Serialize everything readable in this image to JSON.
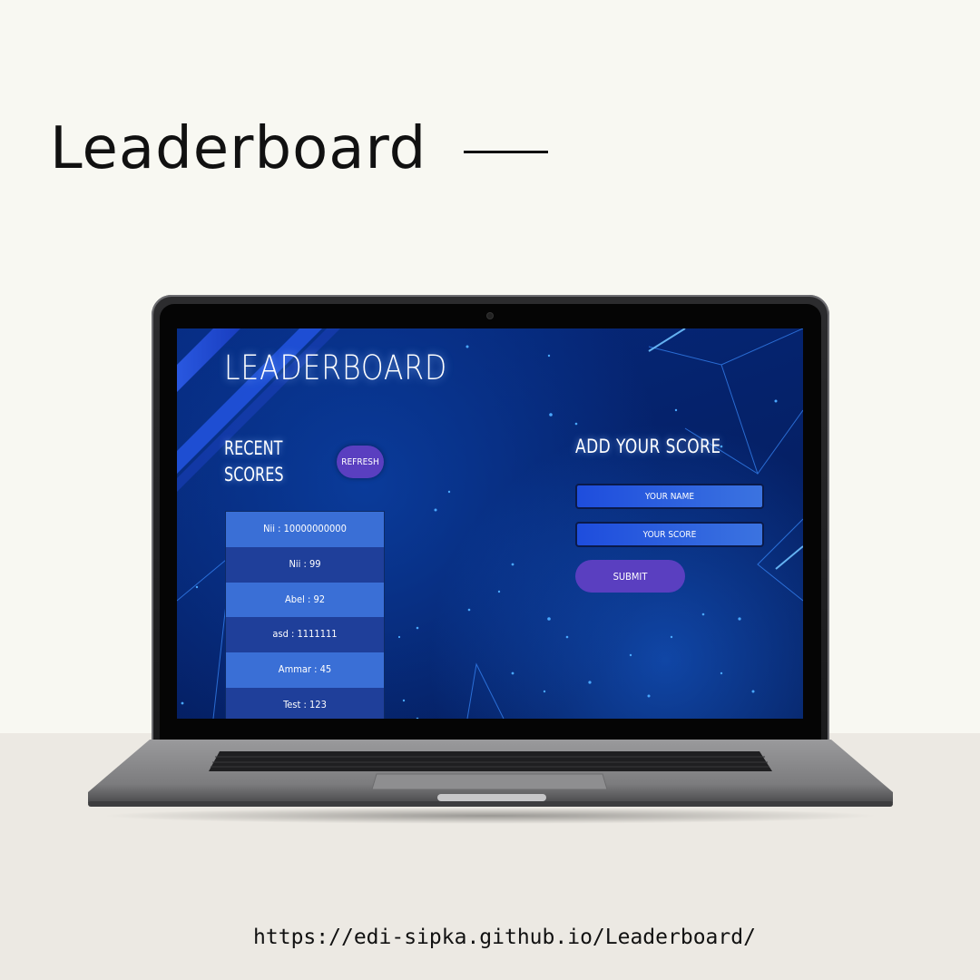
{
  "page": {
    "heading": "Leaderboard",
    "url": "https://edi-sipka.github.io/Leaderboard/"
  },
  "app": {
    "title": "LEADERBOARD",
    "recent_scores": {
      "title": "RECENT SCORES",
      "refresh_label": "REFRESH",
      "scores": [
        "Nii : 10000000000",
        "Nii : 99",
        "Abel : 92",
        "asd : 1111111",
        "Ammar : 45",
        "Test : 123"
      ]
    },
    "add_score": {
      "title": "ADD YOUR SCORE",
      "name_placeholder": "YOUR NAME",
      "score_placeholder": "YOUR SCORE",
      "submit_label": "SUBMIT"
    }
  },
  "colors": {
    "page_background": "#f8f8f2",
    "floor": "#ece9e3",
    "screen_background": "#05226b",
    "button_purple": "#5a3fc0",
    "row_light": "#3a6fd6",
    "row_dark": "#1f3f9a",
    "input_blue": "#1e4ddd"
  }
}
